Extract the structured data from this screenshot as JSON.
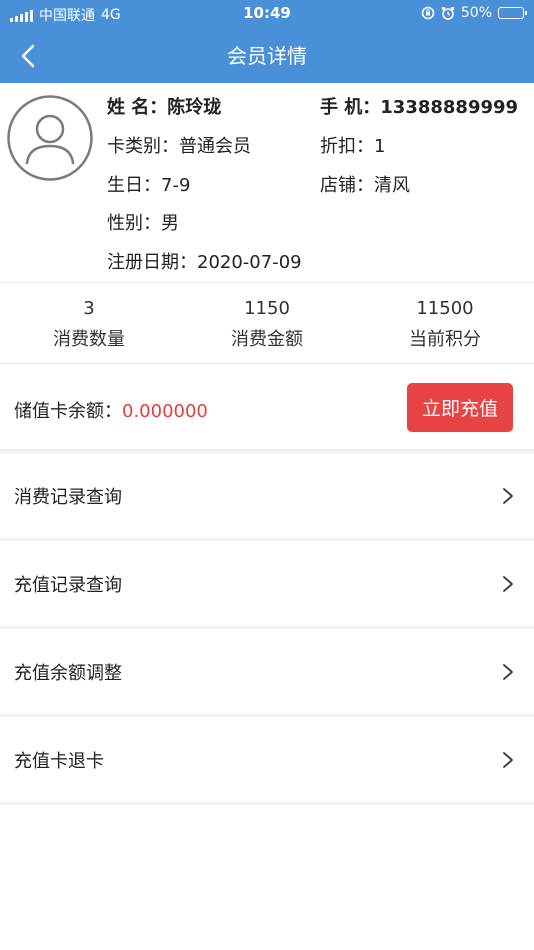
{
  "status_bar": {
    "carrier": "中国联通",
    "network": "4G",
    "time": "10:49",
    "battery_percent": "50%",
    "battery_level": 0.5
  },
  "nav": {
    "title": "会员详情",
    "back_icon": "chevron-left-icon"
  },
  "member": {
    "name_label": "姓 名：",
    "name": "陈玲珑",
    "phone_label": "手 机：",
    "phone": "13388889999",
    "card_type_label": "卡类别：",
    "card_type": "普通会员",
    "discount_label": "折扣：",
    "discount": "1",
    "birthday_label": "生日：",
    "birthday": "7-9",
    "store_label": "店铺：",
    "store": "清风",
    "gender_label": "性别：",
    "gender": "男",
    "reg_date_label": "注册日期：",
    "reg_date": "2020-07-09"
  },
  "stats": [
    {
      "value": "3",
      "label": "消费数量"
    },
    {
      "value": "1150",
      "label": "消费金额"
    },
    {
      "value": "11500",
      "label": "当前积分"
    }
  ],
  "balance": {
    "label": "储值卡余额：",
    "value": "0.000000",
    "button_label": "立即充值"
  },
  "menu": [
    {
      "label": "消费记录查询"
    },
    {
      "label": "充值记录查询"
    },
    {
      "label": "充值余额调整"
    },
    {
      "label": "充值卡退卡"
    }
  ],
  "colors": {
    "header": "#4a90d9",
    "accent_red": "#e84444",
    "balance_value": "#e04040"
  }
}
